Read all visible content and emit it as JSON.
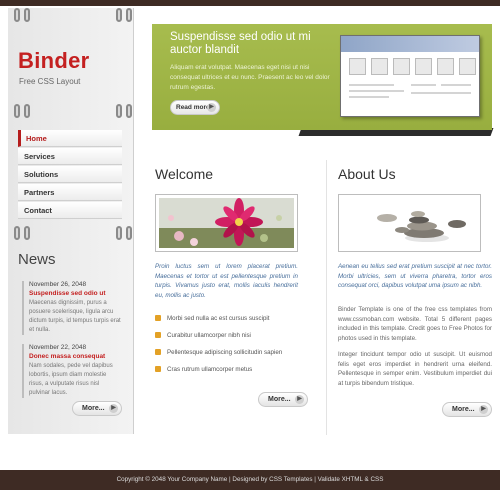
{
  "logo": {
    "title": "Binder",
    "subtitle": "Free CSS Layout"
  },
  "nav": {
    "items": [
      "Home",
      "Services",
      "Solutions",
      "Partners",
      "Contact"
    ]
  },
  "hero": {
    "title": "Suspendisse sed odio ut mi auctor blandit",
    "text": "Aliquam erat volutpat. Maecenas eget nisi ut nisi consequat ultrices et eu nunc. Praesent ac leo vel dolor rutrum egestas.",
    "button": "Read more"
  },
  "news": {
    "title": "News",
    "items": [
      {
        "date": "November 26, 2048",
        "headline": "Suspendisse sed odio ut",
        "text": "Maecenas dignissim, purus a posuere scelerisque, ligula arcu dictum turpis, id tempus turpis erat et nulla."
      },
      {
        "date": "November 22, 2048",
        "headline": "Donec massa consequat",
        "text": "Nam sodales, pede vel dapibus lobortis, ipsum diam molestie risus, a vulputate risus nisl pulvinar lacus."
      }
    ],
    "more": "More..."
  },
  "welcome": {
    "title": "Welcome",
    "intro": "Proin luctus sem ut lorem placerat pretium. Maecenas et tortor ut est pellentesque pretium in turpis. Vivamus justo erat, mollis iaculis hendrerit eu, mollis ac justo.",
    "bullets": [
      "Morbi sed nulla ac est cursus suscipit",
      "Curabitur ullamcorper nibh nisi",
      "Pellentesque adipiscing sollicitudin sapien",
      "Cras rutrum ullamcorper metus"
    ],
    "more": "More..."
  },
  "about": {
    "title": "About Us",
    "intro": "Aenean eu tellus sed erat pretium suscipit at nec tortor. Morbi ultricies, sem ut viverra pharetra, tortor eros consequat orci, dapibus volutpat uma ipsum ac nibh.",
    "p1": "Binder Template is one of the free css templates from www.cssmoban.com website. Total 5 different pages included in this template. Credit goes to Free Photos for photos used in this template.",
    "p2": "Integer tincidunt tempor odio ut suscipit. Ut euismod felis eget eros imperdiet in hendrerit urna eleifend. Pellentesque in semper enim. Vestibulum imperdiet dui at turpis bibendum tristique.",
    "more": "More..."
  },
  "footer": {
    "text": "Copyright © 2048 Your Company Name | Designed by CSS Templates | Validate XHTML & CSS"
  },
  "colors": {
    "accent": "#c42020",
    "hero": "#a7bc4e",
    "topbar": "#3e2b24"
  }
}
